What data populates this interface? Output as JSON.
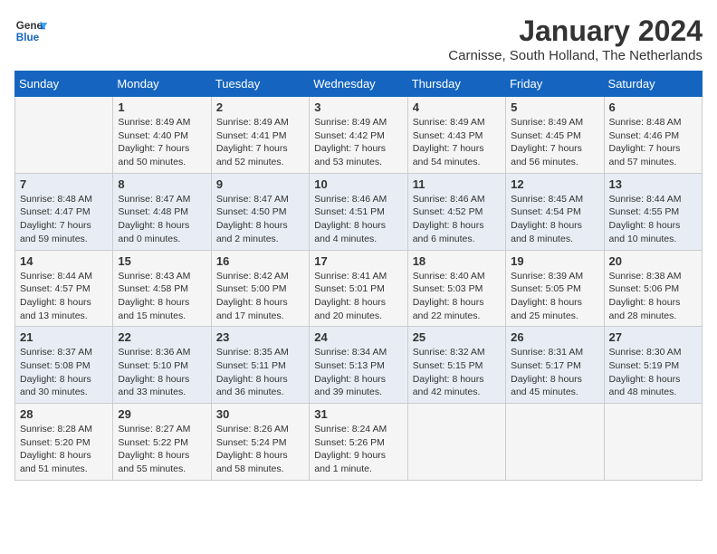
{
  "header": {
    "logo_line1": "General",
    "logo_line2": "Blue",
    "month": "January 2024",
    "location": "Carnisse, South Holland, The Netherlands"
  },
  "days_of_week": [
    "Sunday",
    "Monday",
    "Tuesday",
    "Wednesday",
    "Thursday",
    "Friday",
    "Saturday"
  ],
  "weeks": [
    [
      {
        "day": "",
        "info": ""
      },
      {
        "day": "1",
        "info": "Sunrise: 8:49 AM\nSunset: 4:40 PM\nDaylight: 7 hours\nand 50 minutes."
      },
      {
        "day": "2",
        "info": "Sunrise: 8:49 AM\nSunset: 4:41 PM\nDaylight: 7 hours\nand 52 minutes."
      },
      {
        "day": "3",
        "info": "Sunrise: 8:49 AM\nSunset: 4:42 PM\nDaylight: 7 hours\nand 53 minutes."
      },
      {
        "day": "4",
        "info": "Sunrise: 8:49 AM\nSunset: 4:43 PM\nDaylight: 7 hours\nand 54 minutes."
      },
      {
        "day": "5",
        "info": "Sunrise: 8:49 AM\nSunset: 4:45 PM\nDaylight: 7 hours\nand 56 minutes."
      },
      {
        "day": "6",
        "info": "Sunrise: 8:48 AM\nSunset: 4:46 PM\nDaylight: 7 hours\nand 57 minutes."
      }
    ],
    [
      {
        "day": "7",
        "info": "Sunrise: 8:48 AM\nSunset: 4:47 PM\nDaylight: 7 hours\nand 59 minutes."
      },
      {
        "day": "8",
        "info": "Sunrise: 8:47 AM\nSunset: 4:48 PM\nDaylight: 8 hours\nand 0 minutes."
      },
      {
        "day": "9",
        "info": "Sunrise: 8:47 AM\nSunset: 4:50 PM\nDaylight: 8 hours\nand 2 minutes."
      },
      {
        "day": "10",
        "info": "Sunrise: 8:46 AM\nSunset: 4:51 PM\nDaylight: 8 hours\nand 4 minutes."
      },
      {
        "day": "11",
        "info": "Sunrise: 8:46 AM\nSunset: 4:52 PM\nDaylight: 8 hours\nand 6 minutes."
      },
      {
        "day": "12",
        "info": "Sunrise: 8:45 AM\nSunset: 4:54 PM\nDaylight: 8 hours\nand 8 minutes."
      },
      {
        "day": "13",
        "info": "Sunrise: 8:44 AM\nSunset: 4:55 PM\nDaylight: 8 hours\nand 10 minutes."
      }
    ],
    [
      {
        "day": "14",
        "info": "Sunrise: 8:44 AM\nSunset: 4:57 PM\nDaylight: 8 hours\nand 13 minutes."
      },
      {
        "day": "15",
        "info": "Sunrise: 8:43 AM\nSunset: 4:58 PM\nDaylight: 8 hours\nand 15 minutes."
      },
      {
        "day": "16",
        "info": "Sunrise: 8:42 AM\nSunset: 5:00 PM\nDaylight: 8 hours\nand 17 minutes."
      },
      {
        "day": "17",
        "info": "Sunrise: 8:41 AM\nSunset: 5:01 PM\nDaylight: 8 hours\nand 20 minutes."
      },
      {
        "day": "18",
        "info": "Sunrise: 8:40 AM\nSunset: 5:03 PM\nDaylight: 8 hours\nand 22 minutes."
      },
      {
        "day": "19",
        "info": "Sunrise: 8:39 AM\nSunset: 5:05 PM\nDaylight: 8 hours\nand 25 minutes."
      },
      {
        "day": "20",
        "info": "Sunrise: 8:38 AM\nSunset: 5:06 PM\nDaylight: 8 hours\nand 28 minutes."
      }
    ],
    [
      {
        "day": "21",
        "info": "Sunrise: 8:37 AM\nSunset: 5:08 PM\nDaylight: 8 hours\nand 30 minutes."
      },
      {
        "day": "22",
        "info": "Sunrise: 8:36 AM\nSunset: 5:10 PM\nDaylight: 8 hours\nand 33 minutes."
      },
      {
        "day": "23",
        "info": "Sunrise: 8:35 AM\nSunset: 5:11 PM\nDaylight: 8 hours\nand 36 minutes."
      },
      {
        "day": "24",
        "info": "Sunrise: 8:34 AM\nSunset: 5:13 PM\nDaylight: 8 hours\nand 39 minutes."
      },
      {
        "day": "25",
        "info": "Sunrise: 8:32 AM\nSunset: 5:15 PM\nDaylight: 8 hours\nand 42 minutes."
      },
      {
        "day": "26",
        "info": "Sunrise: 8:31 AM\nSunset: 5:17 PM\nDaylight: 8 hours\nand 45 minutes."
      },
      {
        "day": "27",
        "info": "Sunrise: 8:30 AM\nSunset: 5:19 PM\nDaylight: 8 hours\nand 48 minutes."
      }
    ],
    [
      {
        "day": "28",
        "info": "Sunrise: 8:28 AM\nSunset: 5:20 PM\nDaylight: 8 hours\nand 51 minutes."
      },
      {
        "day": "29",
        "info": "Sunrise: 8:27 AM\nSunset: 5:22 PM\nDaylight: 8 hours\nand 55 minutes."
      },
      {
        "day": "30",
        "info": "Sunrise: 8:26 AM\nSunset: 5:24 PM\nDaylight: 8 hours\nand 58 minutes."
      },
      {
        "day": "31",
        "info": "Sunrise: 8:24 AM\nSunset: 5:26 PM\nDaylight: 9 hours\nand 1 minute."
      },
      {
        "day": "",
        "info": ""
      },
      {
        "day": "",
        "info": ""
      },
      {
        "day": "",
        "info": ""
      }
    ]
  ]
}
